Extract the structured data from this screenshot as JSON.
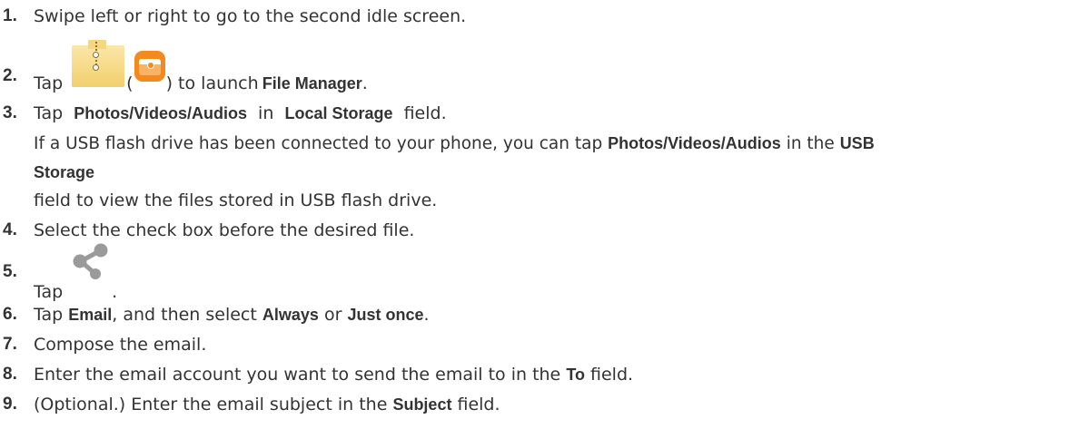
{
  "steps": [
    {
      "number": "1.",
      "parts": {
        "a": "Swipe left or right to go to the second idle screen."
      }
    },
    {
      "number": "2.",
      "parts": {
        "a": "Tap",
        "open_paren": "(",
        "close_paren": ") to launch",
        "bold_1": "File Manager",
        "end": "."
      },
      "icons": {
        "first": "file-manager-folder-icon",
        "second": "file-manager-orange-icon"
      }
    },
    {
      "number": "3.",
      "parts": {
        "a": "Tap",
        "bold_1": "Photos/Videos/Audios",
        "b": "in",
        "bold_2": "Local Storage",
        "c": "field."
      },
      "note_line_1": {
        "a": "If a USB flash drive has been connected to your phone, you can tap",
        "bold_1": "Photos/Videos/Audios",
        "b": "in the",
        "bold_2": "USB"
      },
      "note_line_2": {
        "bold": "Storage"
      },
      "note_line_3": {
        "a": "field to view the files stored in USB flash drive."
      }
    },
    {
      "number": "4.",
      "parts": {
        "a": "Select the check box before the desired file."
      }
    },
    {
      "number": "5.",
      "parts": {
        "a": "Tap",
        "end": "."
      },
      "icons": {
        "first": "share-icon"
      }
    },
    {
      "number": "6.",
      "parts": {
        "a": "Tap",
        "bold_1": "Email",
        "b": ", and then select",
        "bold_2": "Always",
        "c": "or",
        "bold_3": "Just once",
        "end": "."
      }
    },
    {
      "number": "7.",
      "parts": {
        "a": "Compose the email."
      }
    },
    {
      "number": "8.",
      "parts": {
        "a": "Enter the email account you want to send the email to in the",
        "bold_1": "To",
        "b": "field."
      }
    },
    {
      "number": "9.",
      "parts": {
        "a": "(Optional.) Enter the email subject in the",
        "bold_1": "Subject",
        "b": "field."
      }
    }
  ],
  "colors": {
    "text": "#333333",
    "folder_icon": "#f2cf6c",
    "orange_icon": "#f38a20",
    "share_icon": "#9a9a9a"
  }
}
